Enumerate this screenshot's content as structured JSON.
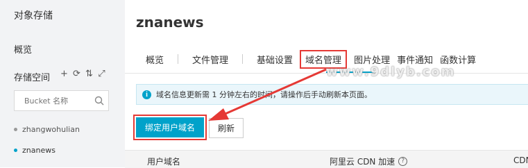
{
  "sidebar": {
    "title": "对象存储",
    "overview": "概览",
    "storage_label": "存储空间",
    "actions": [
      {
        "icon": "plus-icon",
        "glyph": "+"
      },
      {
        "icon": "refresh-icon",
        "glyph": "⟳"
      },
      {
        "icon": "sort-icon",
        "glyph": "⇅"
      },
      {
        "icon": "expand-icon",
        "glyph": "⤢"
      }
    ],
    "search_placeholder": "Bucket 名称",
    "buckets": [
      {
        "name": "zhangwohulian",
        "active": false
      },
      {
        "name": "znanews",
        "active": true
      }
    ]
  },
  "main": {
    "title": "znanews",
    "tabs": [
      {
        "label": "概览"
      },
      {
        "label": "文件管理"
      },
      {
        "label": "基础设置"
      },
      {
        "label": "域名管理",
        "active": true
      },
      {
        "label": "图片处理"
      },
      {
        "label": "事件通知"
      },
      {
        "label": "函数计算"
      }
    ],
    "notice": "域名信息更新需 1 分钟左右的时间，请操作后手动刷新本页面。",
    "bind_button": "绑定用户域名",
    "refresh_button": "刷新",
    "table_headers": [
      "用户域名",
      "阿里云 CDN 加速",
      "CDN"
    ],
    "watermark": "www.9dlyb.com"
  },
  "colors": {
    "accent": "#00a2ca",
    "highlight": "#e53935"
  }
}
